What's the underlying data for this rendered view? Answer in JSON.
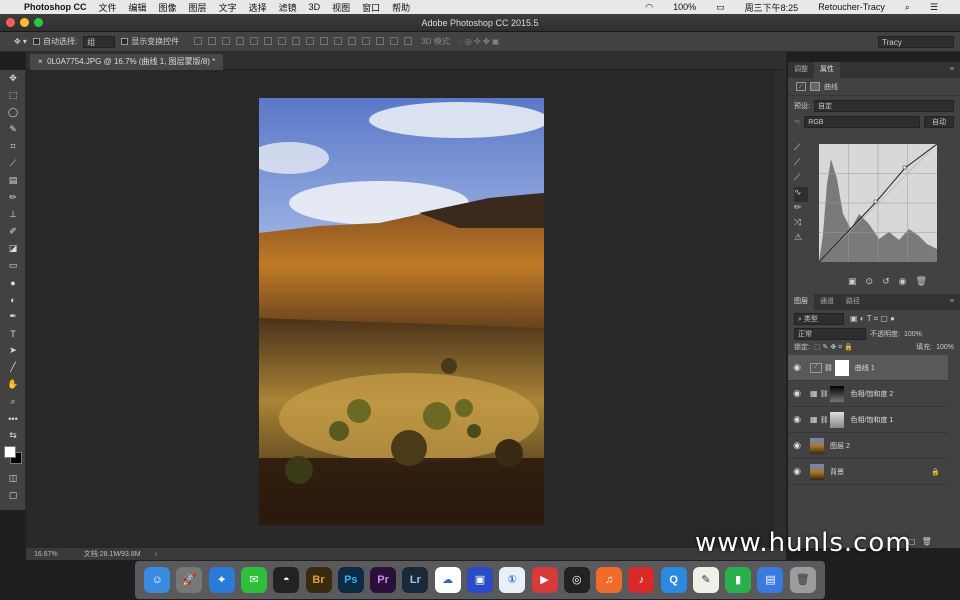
{
  "menubar": {
    "app": "Photoshop CC",
    "items": [
      "文件",
      "编辑",
      "图像",
      "图层",
      "文字",
      "选择",
      "滤镜",
      "3D",
      "视图",
      "窗口",
      "帮助"
    ],
    "battery": "100%",
    "clock": "周三下午8:25",
    "user": "Retoucher-Tracy"
  },
  "window": {
    "title": "Adobe Photoshop CC 2015.5"
  },
  "options": {
    "auto_select": "自动选择:",
    "auto_select_value": "组",
    "show_transform": "显示变换控件",
    "mode3d": "3D 模式:",
    "workspace": "Tracy"
  },
  "doc": {
    "tab": "0L0A7754.JPG @ 16.7% (曲线 1, 图层蒙版/8) *"
  },
  "status": {
    "zoom": "16.67%",
    "docsize": "文档:28.1M/93.8M"
  },
  "tools": [
    "move",
    "marquee",
    "lasso",
    "quick-select",
    "crop",
    "eyedropper",
    "healing",
    "brush",
    "stamp",
    "history-brush",
    "eraser",
    "gradient",
    "blur",
    "dodge",
    "pen",
    "type",
    "path-select",
    "line",
    "hand",
    "zoom",
    "more",
    "swap"
  ],
  "props": {
    "tabs": [
      "调整",
      "属性"
    ],
    "title": "曲线",
    "preset_label": "预设:",
    "preset": "自定",
    "channel": "RGB",
    "auto": "自动"
  },
  "layers": {
    "tabs": [
      "图层",
      "通道",
      "路径"
    ],
    "filter": "类型",
    "blend": "正常",
    "opacity_label": "不透明度:",
    "opacity": "100%",
    "lock_label": "锁定:",
    "fill_label": "填充:",
    "fill": "100%",
    "items": [
      {
        "name": "曲线 1"
      },
      {
        "name": "色相/饱和度 2"
      },
      {
        "name": "色相/饱和度 1"
      },
      {
        "name": "图层 2"
      },
      {
        "name": "背景"
      }
    ]
  },
  "watermark": "www.hunls.com",
  "dock": [
    {
      "label": "Br",
      "color": "#3a2a10"
    },
    {
      "label": "Ps",
      "color": "#0c2a44"
    },
    {
      "label": "Pr",
      "color": "#2a0f3a"
    },
    {
      "label": "Lr",
      "color": "#182a3a"
    }
  ]
}
